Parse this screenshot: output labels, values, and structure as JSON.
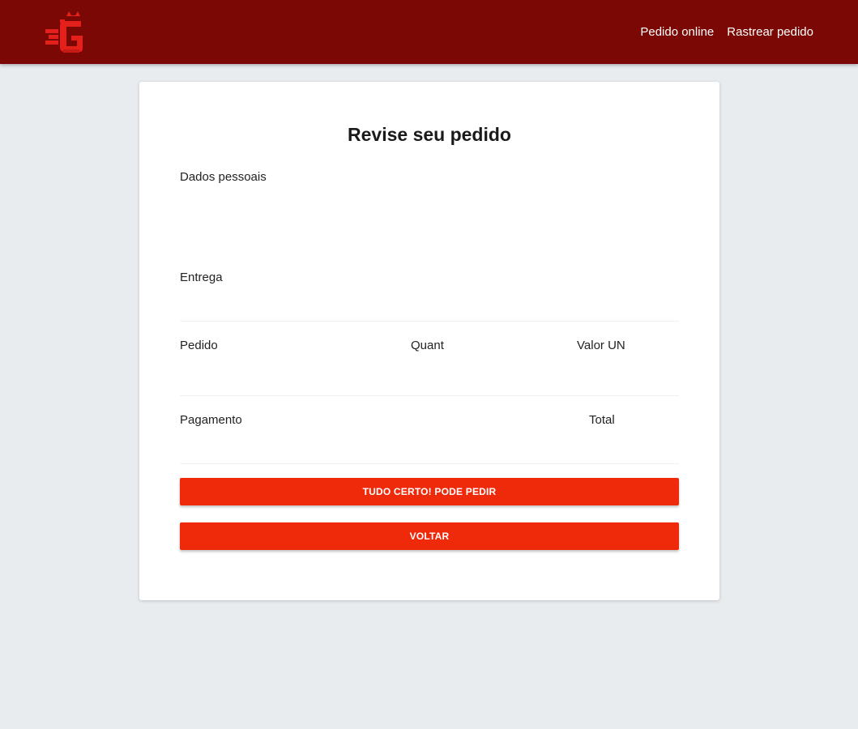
{
  "header": {
    "logo_icon": "restaurant-logo-icon",
    "brand_color": "#7b0804",
    "nav": [
      {
        "label": "Pedido online"
      },
      {
        "label": "Rastrear pedido"
      }
    ]
  },
  "review": {
    "title": "Revise seu pedido",
    "personal_label": "Dados pessoais",
    "delivery_label": "Entrega",
    "order_header": {
      "item": "Pedido",
      "qty": "Quant",
      "unit_value": "Valor UN"
    },
    "payment_label": "Pagamento",
    "total_label": "Total",
    "confirm_button": "TUDO CERTO! PODE PEDIR",
    "back_button": "VOLTAR",
    "accent_color": "#ef2a0a"
  }
}
